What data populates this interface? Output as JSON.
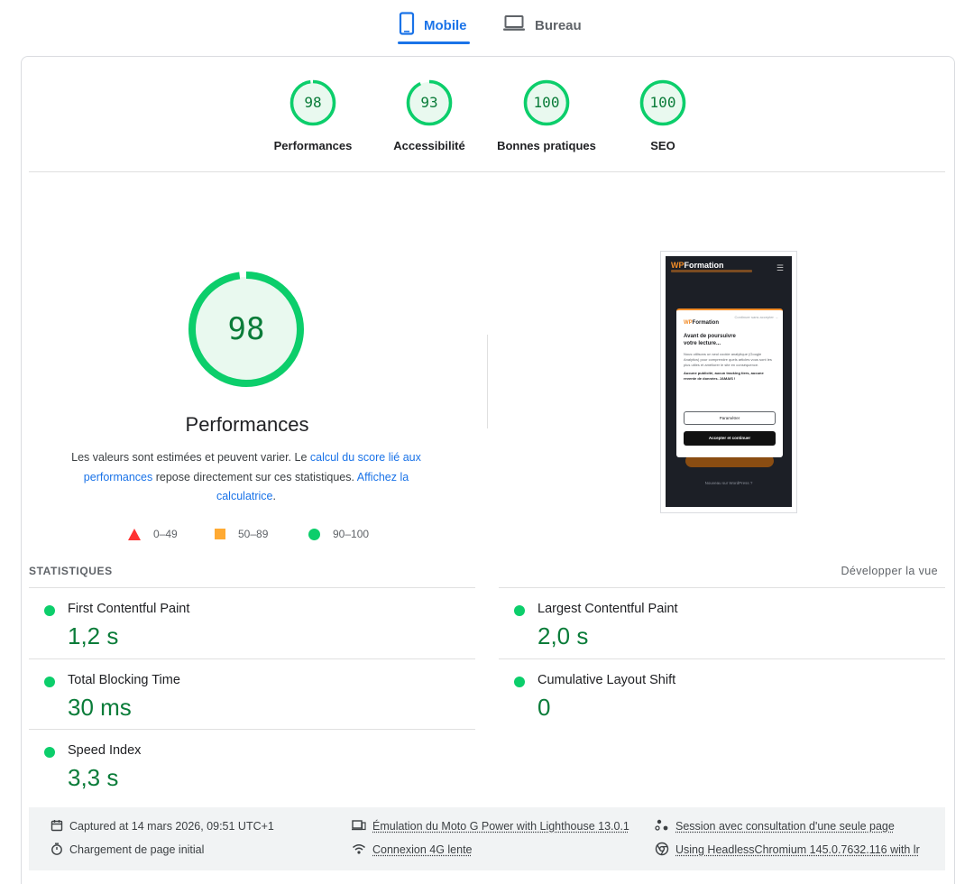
{
  "tabs": {
    "mobile": {
      "label": "Mobile",
      "icon": "smartphone-icon"
    },
    "desktop": {
      "label": "Bureau",
      "icon": "laptop-icon"
    }
  },
  "scores": [
    {
      "label": "Performances",
      "value": "98"
    },
    {
      "label": "Accessibilité",
      "value": "93"
    },
    {
      "label": "Bonnes pratiques",
      "value": "100"
    },
    {
      "label": "SEO",
      "value": "100"
    }
  ],
  "performance": {
    "score": "98",
    "title": "Performances",
    "description_start": "Les valeurs sont estimées et peuvent varier. Le ",
    "link_score": "calcul du score lié aux performances",
    "description_mid": " repose directement sur ces statistiques. ",
    "link_calc": "Affichez la calculatrice",
    "description_end": "."
  },
  "legend": {
    "fail": "0–49",
    "average": "50–89",
    "pass": "90–100"
  },
  "screenshot": {
    "brand_wp": "WP",
    "brand_rest": "Formation",
    "modal_skip": "Continuer sans accepter →",
    "modal_title_1": "Avant de poursuivre",
    "modal_title_2": "votre lecture...",
    "modal_body": "Nous utilisons un seul cookie analytique (Google Analytics) pour comprendre quels articles vous sont les plus utiles et améliorer le site en conséquence.",
    "modal_bold": "Aucune publicité, aucun tracking tiers, aucune revente de données. JAMAIS !",
    "modal_btn_settings": "Paramétrer",
    "modal_btn_accept": "Accepter et continuer",
    "footer_link": "Nouveau sur WordPress ?"
  },
  "metrics": {
    "title": "STATISTIQUES",
    "expand": "Développer la vue",
    "items": [
      {
        "label": "First Contentful Paint",
        "value": "1,2 s"
      },
      {
        "label": "Largest Contentful Paint",
        "value": "2,0 s"
      },
      {
        "label": "Total Blocking Time",
        "value": "30 ms"
      },
      {
        "label": "Cumulative Layout Shift",
        "value": "0"
      },
      {
        "label": "Speed Index",
        "value": "3,3 s"
      }
    ]
  },
  "run_info": {
    "captured": "Captured at 14 mars 2026, 09:51 UTC+1",
    "load": "Chargement de page initial",
    "emulation": "Émulation du Moto G Power with Lighthouse 13.0.1",
    "network": "Connexion 4G lente",
    "session": "Session avec consultation d'une seule page",
    "browser": "Using HeadlessChromium 145.0.7632.116 with lr"
  },
  "colors": {
    "pass": "#0cce6b",
    "pass_text": "#0a7c39",
    "average": "#ffaa33",
    "fail": "#ff3333",
    "accent": "#1a73e8"
  }
}
